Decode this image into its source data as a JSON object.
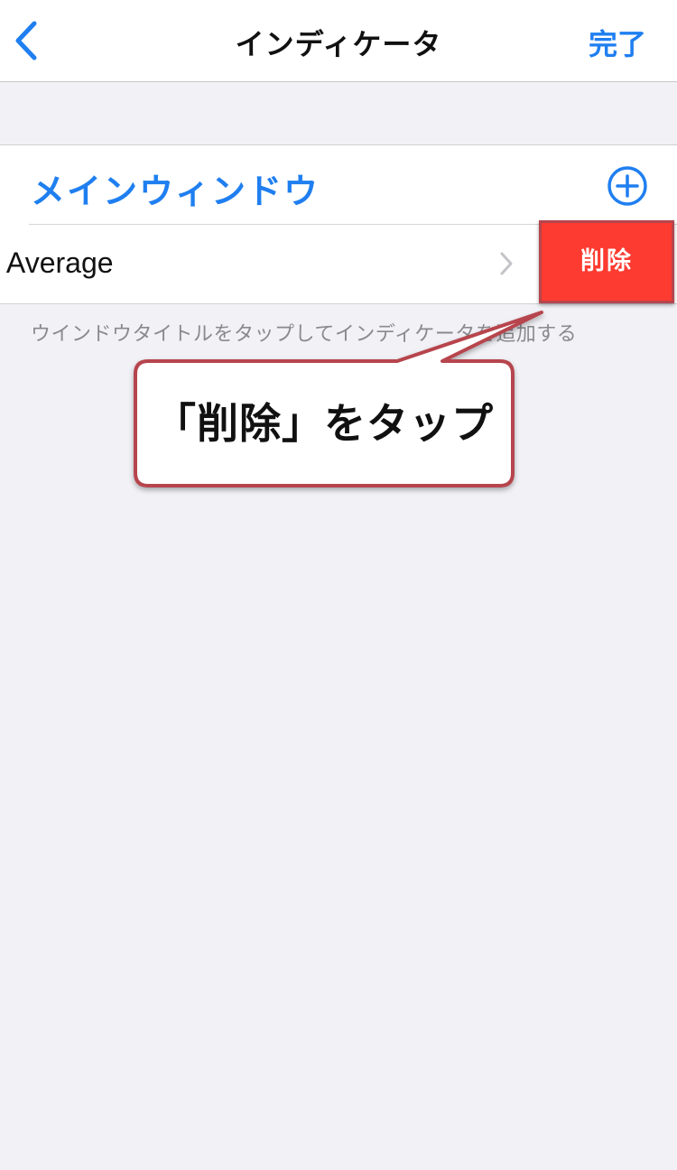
{
  "navbar": {
    "back_icon": "chevron-left-icon",
    "title": "インディケータ",
    "done_label": "完了"
  },
  "section": {
    "title": "メインウィンドウ",
    "add_icon": "plus-circle-icon",
    "row": {
      "label": "n Average",
      "chevron_icon": "chevron-right-icon"
    },
    "footer_note": "ウインドウタイトルをタップしてインディケータを追加する"
  },
  "swipe_action": {
    "delete_label": "削除"
  },
  "callout": {
    "text": "「削除」をタップ"
  },
  "colors": {
    "accent_blue": "#1f7ff0",
    "delete_red": "#fd3b30",
    "callout_border": "#b6454d",
    "background": "#f1f1f6"
  }
}
